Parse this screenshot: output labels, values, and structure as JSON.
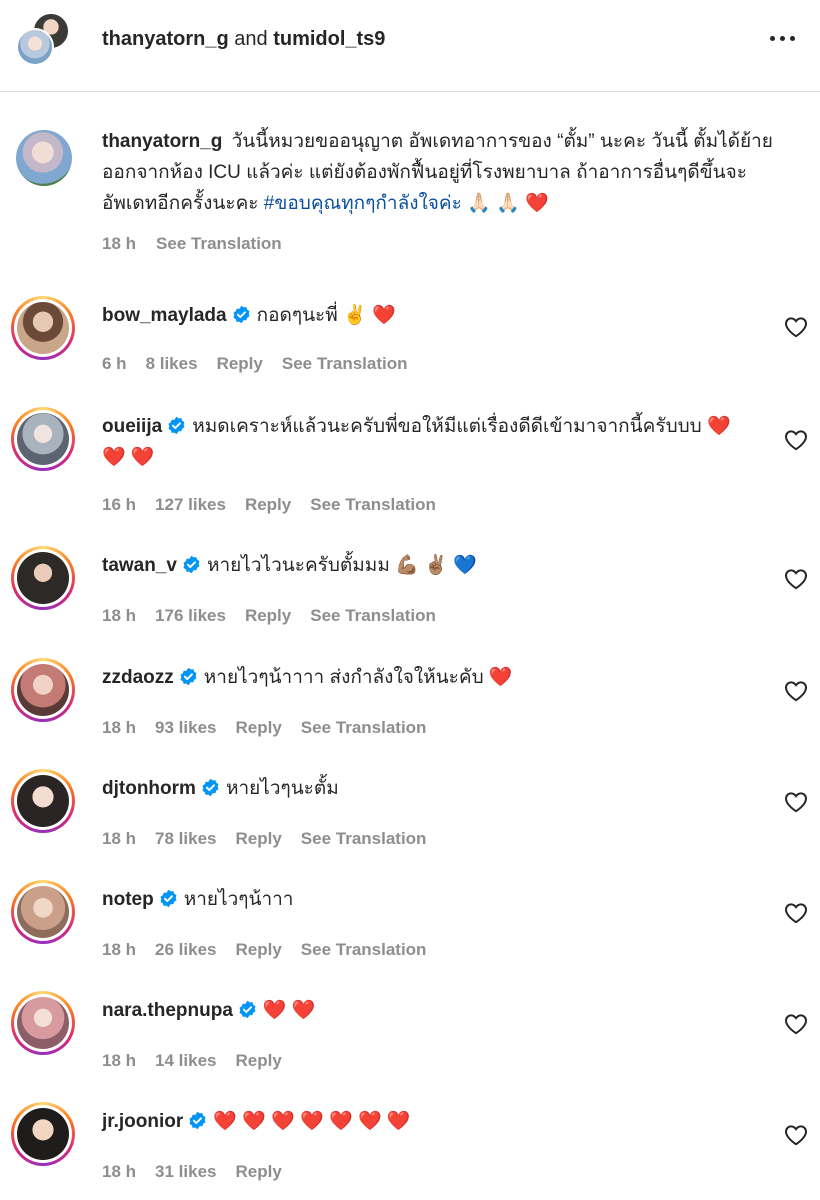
{
  "header": {
    "user1": "thanyatorn_g",
    "and_text": "and",
    "user2": "tumidol_ts9"
  },
  "caption": {
    "username": "thanyatorn_g",
    "text": "วันนี้หมวยขออนุญาต อัพเดทอาการของ “ตั้ม” นะคะ วันนี้ ตั้มได้ย้ายออกจากห้อง ICU แล้วค่ะ แต่ยังต้องพักฟื้นอยู่ที่โรงพยาบาล ถ้าอาการอื่นๆดีขึ้นจะอัพเดทอีกครั้งนะคะ",
    "hashtag": "#ขอบคุณทุกๆกำลังใจค่ะ",
    "emoji": "🙏🏻 🙏🏻 ❤️",
    "time": "18 h",
    "see_translation": "See Translation"
  },
  "comments": [
    {
      "username": "bow_maylada",
      "text": "กอดๆนะพี่ ✌️ ❤️",
      "time": "6 h",
      "likes": "8 likes",
      "reply": "Reply",
      "see_translation": "See Translation"
    },
    {
      "username": "oueiija",
      "text": "หมดเคราะห์แล้วนะครับพี่ขอให้มีแต่เรื่องดีดีเข้ามาจากนี้ครับบบ ❤️ ❤️ ❤️",
      "time": "16 h",
      "likes": "127 likes",
      "reply": "Reply",
      "see_translation": "See Translation"
    },
    {
      "username": "tawan_v",
      "text": "หายไวไวนะครับตั้มมม 💪🏽 ✌🏽 💙",
      "time": "18 h",
      "likes": "176 likes",
      "reply": "Reply",
      "see_translation": "See Translation"
    },
    {
      "username": "zzdaozz",
      "text": "หายไวๆน้าาาา ส่งกำลังใจให้นะคับ ❤️",
      "time": "18 h",
      "likes": "93 likes",
      "reply": "Reply",
      "see_translation": "See Translation"
    },
    {
      "username": "djtonhorm",
      "text": "หายไวๆนะตั้ม",
      "time": "18 h",
      "likes": "78 likes",
      "reply": "Reply",
      "see_translation": "See Translation"
    },
    {
      "username": "notep",
      "text": "หายไวๆน้าาา",
      "time": "18 h",
      "likes": "26 likes",
      "reply": "Reply",
      "see_translation": "See Translation"
    },
    {
      "username": "nara.thepnupa",
      "text": "❤️ ❤️",
      "time": "18 h",
      "likes": "14 likes",
      "reply": "Reply",
      "see_translation": ""
    },
    {
      "username": "jr.joonior",
      "text": "❤️ ❤️ ❤️ ❤️ ❤️ ❤️ ❤️",
      "time": "18 h",
      "likes": "31 likes",
      "reply": "Reply",
      "see_translation": ""
    }
  ],
  "colors": {
    "text": "#262626",
    "muted": "#8e8e8e",
    "hashtag": "#0b4fa0",
    "verified": "#0095f6"
  }
}
